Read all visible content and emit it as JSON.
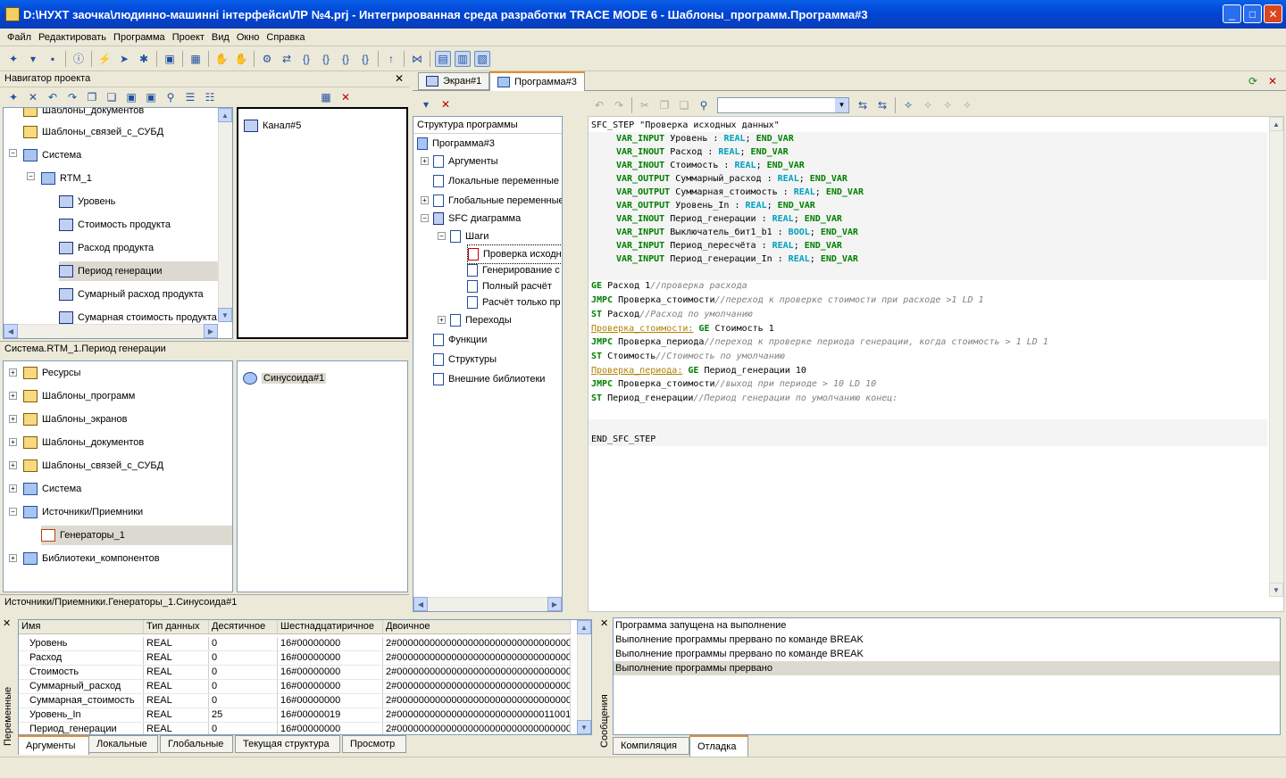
{
  "window": {
    "title": "D:\\НУХТ заочка\\людинно-машинні інтерфейси\\ЛР №4.prj - Интегрированная среда разработки TRACE MODE 6 - Шаблоны_программ.Программа#3"
  },
  "menu": [
    "Файл",
    "Редактировать",
    "Программа",
    "Проект",
    "Вид",
    "Окно",
    "Справка"
  ],
  "navigator": {
    "title": "Навигатор проекта",
    "top_tree": [
      {
        "label": "Шаблоны_документов",
        "indent": 0
      },
      {
        "label": "Шаблоны_связей_с_СУБД",
        "indent": 0
      },
      {
        "label": "Система",
        "indent": 0
      },
      {
        "label": "RTM_1",
        "indent": 1
      },
      {
        "label": "Уровень",
        "indent": 2
      },
      {
        "label": "Стоимость продукта",
        "indent": 2
      },
      {
        "label": "Расход продукта",
        "indent": 2
      },
      {
        "label": "Период генерации",
        "indent": 2
      },
      {
        "label": "Сумарный расход продукта",
        "indent": 2
      },
      {
        "label": "Сумарная стоимость продукта",
        "indent": 2
      }
    ],
    "top_right_item": "Канал#5",
    "top_status": "Система.RTM_1.Период генерации",
    "bottom_tree": [
      {
        "label": "Ресурсы",
        "indent": 0
      },
      {
        "label": "Шаблоны_программ",
        "indent": 0
      },
      {
        "label": "Шаблоны_экранов",
        "indent": 0
      },
      {
        "label": "Шаблоны_документов",
        "indent": 0
      },
      {
        "label": "Шаблоны_связей_с_СУБД",
        "indent": 0
      },
      {
        "label": "Система",
        "indent": 0
      },
      {
        "label": "Источники/Приемники",
        "indent": 0
      },
      {
        "label": "Генераторы_1",
        "indent": 1
      },
      {
        "label": "Библиотеки_компонентов",
        "indent": 0
      }
    ],
    "bottom_right_item": "Синусоида#1",
    "bottom_status": "Источники/Приемники.Генераторы_1.Синусоида#1"
  },
  "doc_tabs": [
    "Экран#1",
    "Программа#3"
  ],
  "structure": {
    "title": "Структура программы",
    "items": [
      {
        "label": "Программа#3",
        "indent": 0
      },
      {
        "label": "Аргументы",
        "indent": 1
      },
      {
        "label": "Локальные переменные",
        "indent": 1
      },
      {
        "label": "Глобальные переменные",
        "indent": 1
      },
      {
        "label": "SFC диаграмма",
        "indent": 1
      },
      {
        "label": "Шаги",
        "indent": 2
      },
      {
        "label": "Проверка исходн",
        "indent": 3
      },
      {
        "label": "Генерирование с",
        "indent": 3
      },
      {
        "label": "Полный расчёт",
        "indent": 3
      },
      {
        "label": "Расчёт только пр",
        "indent": 3
      },
      {
        "label": "Переходы",
        "indent": 2
      },
      {
        "label": "Функции",
        "indent": 1
      },
      {
        "label": "Структуры",
        "indent": 1
      },
      {
        "label": "Внешние библиотеки",
        "indent": 1
      }
    ]
  },
  "code": {
    "step_header": "SFC_STEP \"Проверка исходных данных\"",
    "vars": [
      {
        "kind": "VAR_INPUT",
        "name": "Уровень",
        "type": "REAL"
      },
      {
        "kind": "VAR_INOUT",
        "name": "Расход",
        "type": "REAL"
      },
      {
        "kind": "VAR_INOUT",
        "name": "Стоимость",
        "type": "REAL"
      },
      {
        "kind": "VAR_OUTPUT",
        "name": "Суммарный_расход",
        "type": "REAL"
      },
      {
        "kind": "VAR_OUTPUT",
        "name": "Суммарная_стоимость",
        "type": "REAL"
      },
      {
        "kind": "VAR_OUTPUT",
        "name": "Уровень_In",
        "type": "REAL"
      },
      {
        "kind": "VAR_INOUT",
        "name": "Период_генерации",
        "type": "REAL"
      },
      {
        "kind": "VAR_INPUT",
        "name": "Выключатель_бит1_b1",
        "type": "BOOL"
      },
      {
        "kind": "VAR_INPUT",
        "name": "Период_пересчёта",
        "type": "REAL"
      },
      {
        "kind": "VAR_INPUT",
        "name": "Период_генерации_In",
        "type": "REAL"
      }
    ],
    "end_var": "END_VAR",
    "body": [
      {
        "label": "",
        "op": "GE",
        "arg": "Расход 1",
        "comment": "//проверка расхода"
      },
      {
        "label": "",
        "op": "JMPC",
        "arg": "Проверка_стоимости",
        "comment": "//переход к проверке стоимости при расходе >1 LD 1"
      },
      {
        "label": "",
        "op": "ST",
        "arg": "Расход",
        "comment": "//Расход по умолчанию"
      },
      {
        "label": "Проверка_стоимости:",
        "op": "GE",
        "arg": "Стоимость 1",
        "comment": ""
      },
      {
        "label": "",
        "op": "JMPC",
        "arg": "Проверка_периода",
        "comment": "//переход к проверке периода генерации, когда стоимость > 1 LD 1"
      },
      {
        "label": "",
        "op": "ST",
        "arg": "Стоимость",
        "comment": "//Стоимость по умолчанию"
      },
      {
        "label": "Проверка_периода:",
        "op": "GE",
        "arg": "Период_генерации 10",
        "comment": ""
      },
      {
        "label": "",
        "op": "JMPC",
        "arg": "Проверка_стоимости",
        "comment": "//выход при периоде > 10 LD 10"
      },
      {
        "label": "",
        "op": "ST",
        "arg": "Период_генерации",
        "comment": "//Период генерации по умолчанию конец:"
      }
    ],
    "end_step": "END_SFC_STEP"
  },
  "variables": {
    "side_label": "Переменные",
    "columns": [
      "Имя",
      "Тип данных",
      "Десятичное",
      "Шестнадцатиричное",
      "Двоичное"
    ],
    "rows": [
      [
        "Уровень",
        "REAL",
        "0",
        "16#00000000",
        "2#00000000000000000000000000000000"
      ],
      [
        "Расход",
        "REAL",
        "0",
        "16#00000000",
        "2#00000000000000000000000000000000"
      ],
      [
        "Стоимость",
        "REAL",
        "0",
        "16#00000000",
        "2#00000000000000000000000000000000"
      ],
      [
        "Суммарный_расход",
        "REAL",
        "0",
        "16#00000000",
        "2#00000000000000000000000000000000"
      ],
      [
        "Суммарная_стоимость",
        "REAL",
        "0",
        "16#00000000",
        "2#00000000000000000000000000000000"
      ],
      [
        "Уровень_In",
        "REAL",
        "25",
        "16#00000019",
        "2#00000000000000000000000000011001"
      ],
      [
        "Период_генерации",
        "REAL",
        "0",
        "16#00000000",
        "2#00000000000000000000000000000000"
      ]
    ],
    "tabs": [
      "Аргументы",
      "Локальные",
      "Глобальные",
      "Текущая структура",
      "Просмотр"
    ]
  },
  "messages": {
    "side_label": "Сообщения",
    "lines": [
      "Программа запущена на выполнение",
      "Выполнение программы прервано по команде BREAK",
      "Выполнение программы прервано по команде BREAK",
      "Выполнение программы прервано"
    ],
    "tabs": [
      "Компиляция",
      "Отладка"
    ]
  }
}
